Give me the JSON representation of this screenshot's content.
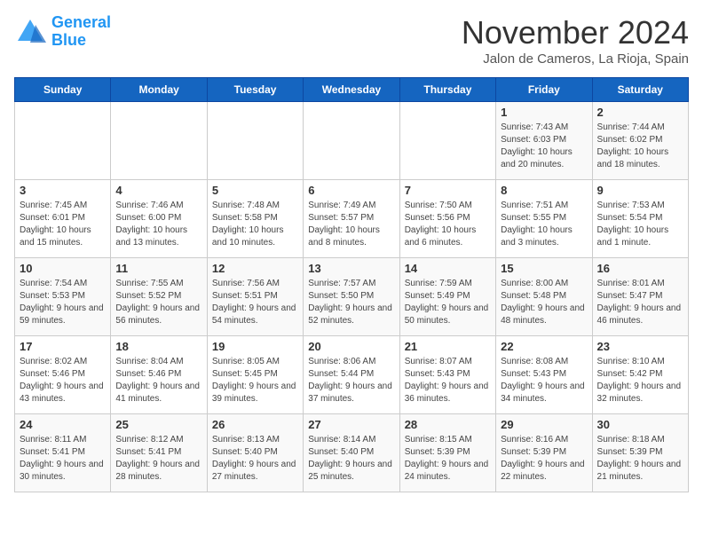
{
  "header": {
    "logo_line1": "General",
    "logo_line2": "Blue",
    "month": "November 2024",
    "location": "Jalon de Cameros, La Rioja, Spain"
  },
  "days_of_week": [
    "Sunday",
    "Monday",
    "Tuesday",
    "Wednesday",
    "Thursday",
    "Friday",
    "Saturday"
  ],
  "weeks": [
    [
      {
        "day": "",
        "text": ""
      },
      {
        "day": "",
        "text": ""
      },
      {
        "day": "",
        "text": ""
      },
      {
        "day": "",
        "text": ""
      },
      {
        "day": "",
        "text": ""
      },
      {
        "day": "1",
        "text": "Sunrise: 7:43 AM\nSunset: 6:03 PM\nDaylight: 10 hours and 20 minutes."
      },
      {
        "day": "2",
        "text": "Sunrise: 7:44 AM\nSunset: 6:02 PM\nDaylight: 10 hours and 18 minutes."
      }
    ],
    [
      {
        "day": "3",
        "text": "Sunrise: 7:45 AM\nSunset: 6:01 PM\nDaylight: 10 hours and 15 minutes."
      },
      {
        "day": "4",
        "text": "Sunrise: 7:46 AM\nSunset: 6:00 PM\nDaylight: 10 hours and 13 minutes."
      },
      {
        "day": "5",
        "text": "Sunrise: 7:48 AM\nSunset: 5:58 PM\nDaylight: 10 hours and 10 minutes."
      },
      {
        "day": "6",
        "text": "Sunrise: 7:49 AM\nSunset: 5:57 PM\nDaylight: 10 hours and 8 minutes."
      },
      {
        "day": "7",
        "text": "Sunrise: 7:50 AM\nSunset: 5:56 PM\nDaylight: 10 hours and 6 minutes."
      },
      {
        "day": "8",
        "text": "Sunrise: 7:51 AM\nSunset: 5:55 PM\nDaylight: 10 hours and 3 minutes."
      },
      {
        "day": "9",
        "text": "Sunrise: 7:53 AM\nSunset: 5:54 PM\nDaylight: 10 hours and 1 minute."
      }
    ],
    [
      {
        "day": "10",
        "text": "Sunrise: 7:54 AM\nSunset: 5:53 PM\nDaylight: 9 hours and 59 minutes."
      },
      {
        "day": "11",
        "text": "Sunrise: 7:55 AM\nSunset: 5:52 PM\nDaylight: 9 hours and 56 minutes."
      },
      {
        "day": "12",
        "text": "Sunrise: 7:56 AM\nSunset: 5:51 PM\nDaylight: 9 hours and 54 minutes."
      },
      {
        "day": "13",
        "text": "Sunrise: 7:57 AM\nSunset: 5:50 PM\nDaylight: 9 hours and 52 minutes."
      },
      {
        "day": "14",
        "text": "Sunrise: 7:59 AM\nSunset: 5:49 PM\nDaylight: 9 hours and 50 minutes."
      },
      {
        "day": "15",
        "text": "Sunrise: 8:00 AM\nSunset: 5:48 PM\nDaylight: 9 hours and 48 minutes."
      },
      {
        "day": "16",
        "text": "Sunrise: 8:01 AM\nSunset: 5:47 PM\nDaylight: 9 hours and 46 minutes."
      }
    ],
    [
      {
        "day": "17",
        "text": "Sunrise: 8:02 AM\nSunset: 5:46 PM\nDaylight: 9 hours and 43 minutes."
      },
      {
        "day": "18",
        "text": "Sunrise: 8:04 AM\nSunset: 5:46 PM\nDaylight: 9 hours and 41 minutes."
      },
      {
        "day": "19",
        "text": "Sunrise: 8:05 AM\nSunset: 5:45 PM\nDaylight: 9 hours and 39 minutes."
      },
      {
        "day": "20",
        "text": "Sunrise: 8:06 AM\nSunset: 5:44 PM\nDaylight: 9 hours and 37 minutes."
      },
      {
        "day": "21",
        "text": "Sunrise: 8:07 AM\nSunset: 5:43 PM\nDaylight: 9 hours and 36 minutes."
      },
      {
        "day": "22",
        "text": "Sunrise: 8:08 AM\nSunset: 5:43 PM\nDaylight: 9 hours and 34 minutes."
      },
      {
        "day": "23",
        "text": "Sunrise: 8:10 AM\nSunset: 5:42 PM\nDaylight: 9 hours and 32 minutes."
      }
    ],
    [
      {
        "day": "24",
        "text": "Sunrise: 8:11 AM\nSunset: 5:41 PM\nDaylight: 9 hours and 30 minutes."
      },
      {
        "day": "25",
        "text": "Sunrise: 8:12 AM\nSunset: 5:41 PM\nDaylight: 9 hours and 28 minutes."
      },
      {
        "day": "26",
        "text": "Sunrise: 8:13 AM\nSunset: 5:40 PM\nDaylight: 9 hours and 27 minutes."
      },
      {
        "day": "27",
        "text": "Sunrise: 8:14 AM\nSunset: 5:40 PM\nDaylight: 9 hours and 25 minutes."
      },
      {
        "day": "28",
        "text": "Sunrise: 8:15 AM\nSunset: 5:39 PM\nDaylight: 9 hours and 24 minutes."
      },
      {
        "day": "29",
        "text": "Sunrise: 8:16 AM\nSunset: 5:39 PM\nDaylight: 9 hours and 22 minutes."
      },
      {
        "day": "30",
        "text": "Sunrise: 8:18 AM\nSunset: 5:39 PM\nDaylight: 9 hours and 21 minutes."
      }
    ]
  ]
}
